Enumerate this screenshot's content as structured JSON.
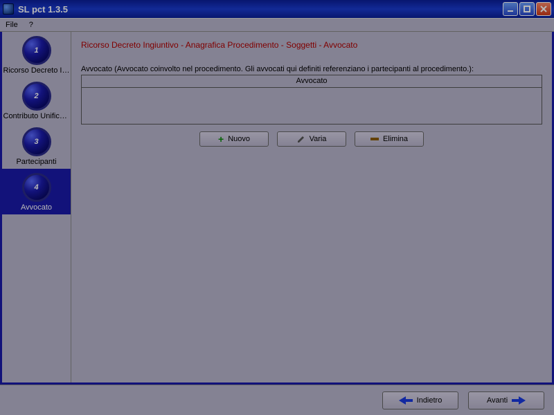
{
  "window": {
    "title": "SL pct 1.3.5"
  },
  "menubar": {
    "file": "File",
    "help": "?"
  },
  "sidebar": {
    "steps": [
      {
        "num": "1",
        "label": "Ricorso Decreto In..."
      },
      {
        "num": "2",
        "label": "Contributo Unificato"
      },
      {
        "num": "3",
        "label": "Partecipanti"
      },
      {
        "num": "4",
        "label": "Avvocato"
      }
    ],
    "selected_index": 3
  },
  "breadcrumb": "Ricorso Decreto Ingiuntivo - Anagrafica Procedimento - Soggetti - Avvocato",
  "section": {
    "label": "Avvocato (Avvocato coinvolto nel procedimento. Gli avvocati qui definiti referenziano  i partecipanti al procedimento.):",
    "columns": [
      "Avvocato"
    ],
    "rows": []
  },
  "actions": {
    "new": "Nuovo",
    "edit": "Varia",
    "delete": "Elimina"
  },
  "footer": {
    "back": "Indietro",
    "next": "Avanti"
  }
}
